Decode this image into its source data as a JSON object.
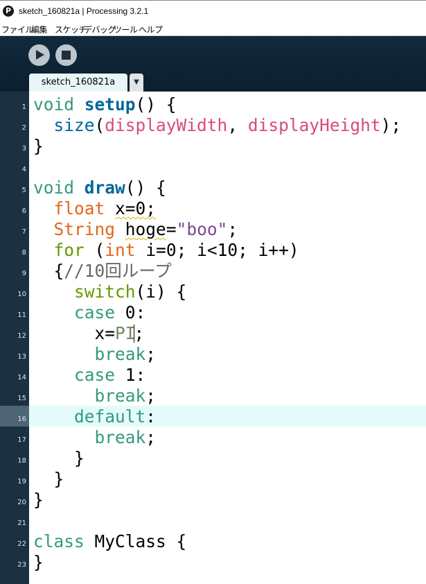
{
  "window": {
    "title": "sketch_160821a | Processing 3.2.1",
    "app_icon": "P"
  },
  "menu": [
    "ファイル",
    "編集",
    "スケッチ",
    "デバッグ",
    "ツール",
    "ヘルプ"
  ],
  "toolbar": {
    "run_icon": "play-icon",
    "stop_icon": "stop-icon"
  },
  "tab": {
    "label": "sketch_160821a",
    "menu_glyph": "▼"
  },
  "line_numbers": [
    "1",
    "2",
    "3",
    "4",
    "5",
    "6",
    "7",
    "8",
    "9",
    "10",
    "11",
    "12",
    "13",
    "14",
    "15",
    "16",
    "17",
    "18",
    "19",
    "20",
    "21",
    "22",
    "23"
  ],
  "highlighted_line": "16",
  "code_tokens": {
    "l1": [
      "void",
      "setup",
      "() {"
    ],
    "l2": [
      "size",
      "(",
      "displayWidth",
      ", ",
      "displayHeight",
      ");"
    ],
    "l3": [
      "}"
    ],
    "l5": [
      "void",
      "draw",
      "() {"
    ],
    "l6": [
      "float",
      "x=0;"
    ],
    "l7": [
      "String",
      "hoge",
      "=",
      "\"boo\"",
      ";"
    ],
    "l8": [
      "for",
      " (",
      "int",
      " i=0; i<10; i++)"
    ],
    "l9": [
      "{",
      "//10回ループ"
    ],
    "l10": [
      "switch",
      "(i) {"
    ],
    "l11": [
      "case",
      " 0:"
    ],
    "l12": [
      "x=",
      "PI",
      ";"
    ],
    "l13": [
      "break",
      ";"
    ],
    "l14": [
      "case",
      " 1:"
    ],
    "l15": [
      "break",
      ";"
    ],
    "l16": [
      "default",
      ":"
    ],
    "l17": [
      "break",
      ";"
    ],
    "l18": [
      "}"
    ],
    "l19": [
      "}"
    ],
    "l20": [
      "}"
    ],
    "l22": [
      "class",
      " MyClass {"
    ],
    "l23": [
      "}"
    ]
  },
  "colors": {
    "keyword": "#33997e",
    "function": "#006699",
    "type": "#e2661a",
    "constant": "#d94a7a",
    "string": "#7d4793",
    "control": "#669900",
    "comment": "#666666",
    "gutter": "#1b3142",
    "highlight": "#e4fbfb"
  }
}
